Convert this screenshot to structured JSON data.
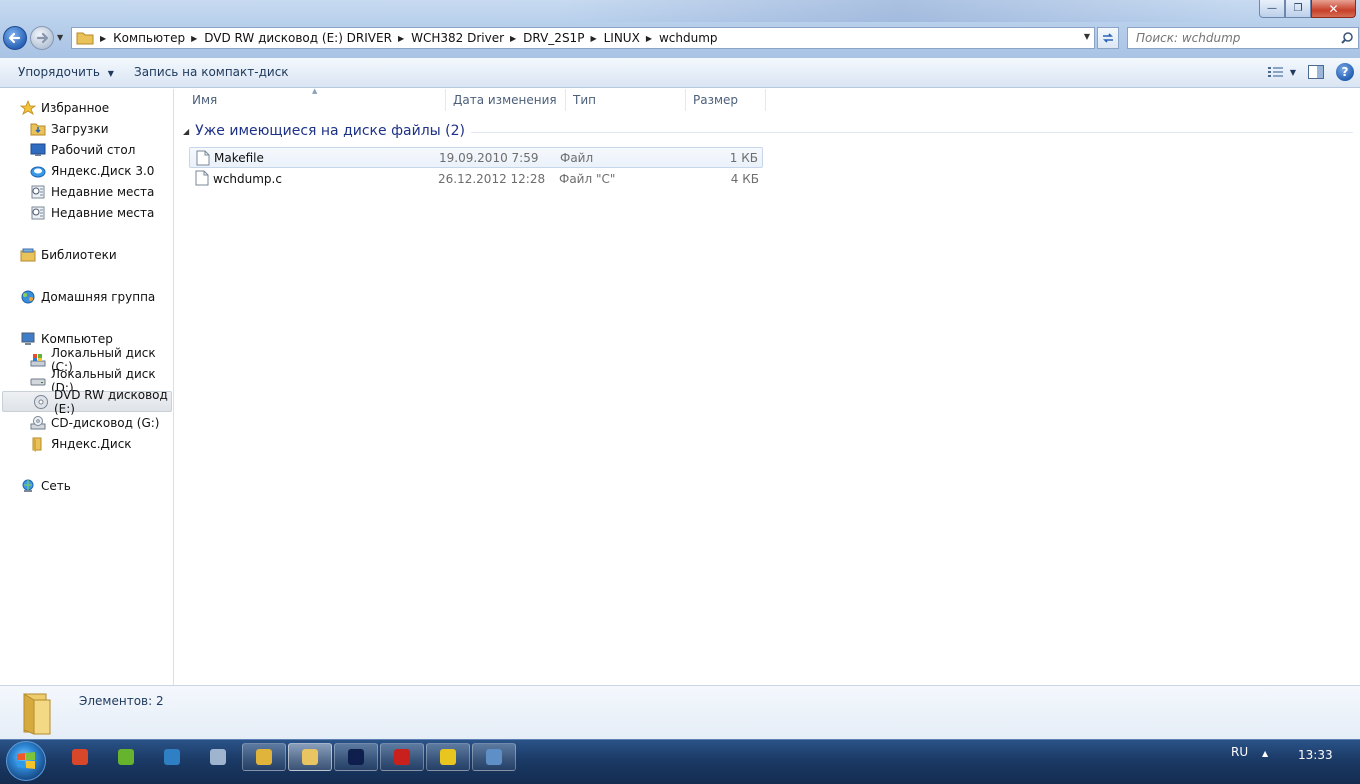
{
  "window": {
    "minimize_label": "—",
    "maximize_label": "❐",
    "close_label": "✕"
  },
  "address": {
    "crumbs": [
      "Компьютер",
      "DVD RW дисковод (E:) DRIVER",
      "WCH382 Driver",
      "DRV_2S1P",
      "LINUX",
      "wchdump"
    ]
  },
  "search": {
    "placeholder": "Поиск: wchdump"
  },
  "toolbar": {
    "organize_label": "Упорядочить",
    "burn_label": "Запись на компакт-диск"
  },
  "sidebar": {
    "favorites": {
      "label": "Избранное",
      "icon": "star-icon"
    },
    "favorite_items": [
      {
        "label": "Загрузки",
        "icon": "downloads-folder-icon"
      },
      {
        "label": "Рабочий стол",
        "icon": "desktop-icon"
      },
      {
        "label": "Яндекс.Диск 3.0",
        "icon": "yandex-disk-icon"
      },
      {
        "label": "Недавние места",
        "icon": "recent-places-icon"
      },
      {
        "label": "Недавние места",
        "icon": "recent-places-icon"
      }
    ],
    "libraries": {
      "label": "Библиотеки",
      "icon": "libraries-icon"
    },
    "homegroup": {
      "label": "Домашняя группа",
      "icon": "homegroup-icon"
    },
    "computer": {
      "label": "Компьютер",
      "icon": "computer-icon"
    },
    "computer_items": [
      {
        "label": "Локальный диск (C:)",
        "icon": "system-drive-icon"
      },
      {
        "label": "Локальный диск (D:)",
        "icon": "hard-drive-icon"
      },
      {
        "label": "DVD RW дисковод (E:)",
        "icon": "dvd-drive-icon"
      },
      {
        "label": "CD-дисковод (G:)",
        "icon": "cd-drive-icon"
      },
      {
        "label": "Яндекс.Диск",
        "icon": "folder-icon"
      }
    ],
    "network": {
      "label": "Сеть",
      "icon": "network-icon"
    }
  },
  "columns": {
    "name": "Имя",
    "date": "Дата изменения",
    "type": "Тип",
    "size": "Размер"
  },
  "group": {
    "title": "Уже имеющиеся на диске файлы (2)"
  },
  "files": [
    {
      "name": "Makefile",
      "date": "19.09.2010 7:59",
      "type": "Файл",
      "size": "1 КБ"
    },
    {
      "name": "wchdump.c",
      "date": "26.12.2012 12:28",
      "type": "Файл \"C\"",
      "size": "4 КБ"
    }
  ],
  "details": {
    "count": "Элементов: 2"
  },
  "taskbar": {
    "apps": [
      {
        "name": "ccleaner-icon",
        "color": "#d9472b"
      },
      {
        "name": "utorrent-icon",
        "color": "#66b32e"
      },
      {
        "name": "k-app-icon",
        "color": "#2f7fc4"
      },
      {
        "name": "calculator-icon",
        "color": "#9fb5cf"
      },
      {
        "name": "chrome-icon",
        "color": "#e0b43a"
      },
      {
        "name": "explorer-icon",
        "color": "#e8c463"
      },
      {
        "name": "photoshop-icon",
        "color": "#0f1f4d"
      },
      {
        "name": "acrobat-icon",
        "color": "#c8201d"
      },
      {
        "name": "1c-icon",
        "color": "#e8c51f"
      },
      {
        "name": "remote-desktop-icon",
        "color": "#5e8fc7"
      }
    ],
    "lang": "RU",
    "tray_arrow": "▲",
    "time": "13:33"
  }
}
